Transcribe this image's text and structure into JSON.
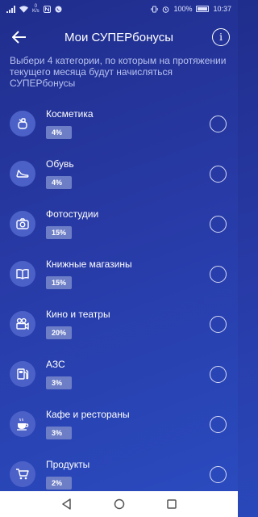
{
  "status": {
    "icons_left": [
      "signal-icon",
      "wifi-icon",
      "speed-icon",
      "nfc-icon",
      "viber-icon"
    ],
    "speed": "0\nK/s",
    "battery": "100%",
    "time": "10:37"
  },
  "header": {
    "title": "Мои СУПЕРбонусы",
    "info_label": "i"
  },
  "intro": "Выбери 4 категории, по которым на протяжении текущего месяца будут начисляться СУПЕРбонусы",
  "categories": [
    {
      "name": "Косметика",
      "percent": "4%",
      "icon": "cosmetics-icon"
    },
    {
      "name": "Обувь",
      "percent": "4%",
      "icon": "shoe-icon"
    },
    {
      "name": "Фотостудии",
      "percent": "15%",
      "icon": "camera-icon"
    },
    {
      "name": "Книжные магазины",
      "percent": "15%",
      "icon": "book-icon"
    },
    {
      "name": "Кино и театры",
      "percent": "20%",
      "icon": "movie-camera-icon"
    },
    {
      "name": "АЗС",
      "percent": "3%",
      "icon": "gas-station-icon"
    },
    {
      "name": "Кафе и рестораны",
      "percent": "3%",
      "icon": "coffee-cup-icon"
    },
    {
      "name": "Продукты",
      "percent": "2%",
      "icon": "shopping-cart-icon"
    }
  ],
  "colors": {
    "background_top": "#1f2d8c",
    "background_bottom": "#2a4cc0",
    "icon_circle": "#4c61c8",
    "badge": "#6d7ec7"
  }
}
